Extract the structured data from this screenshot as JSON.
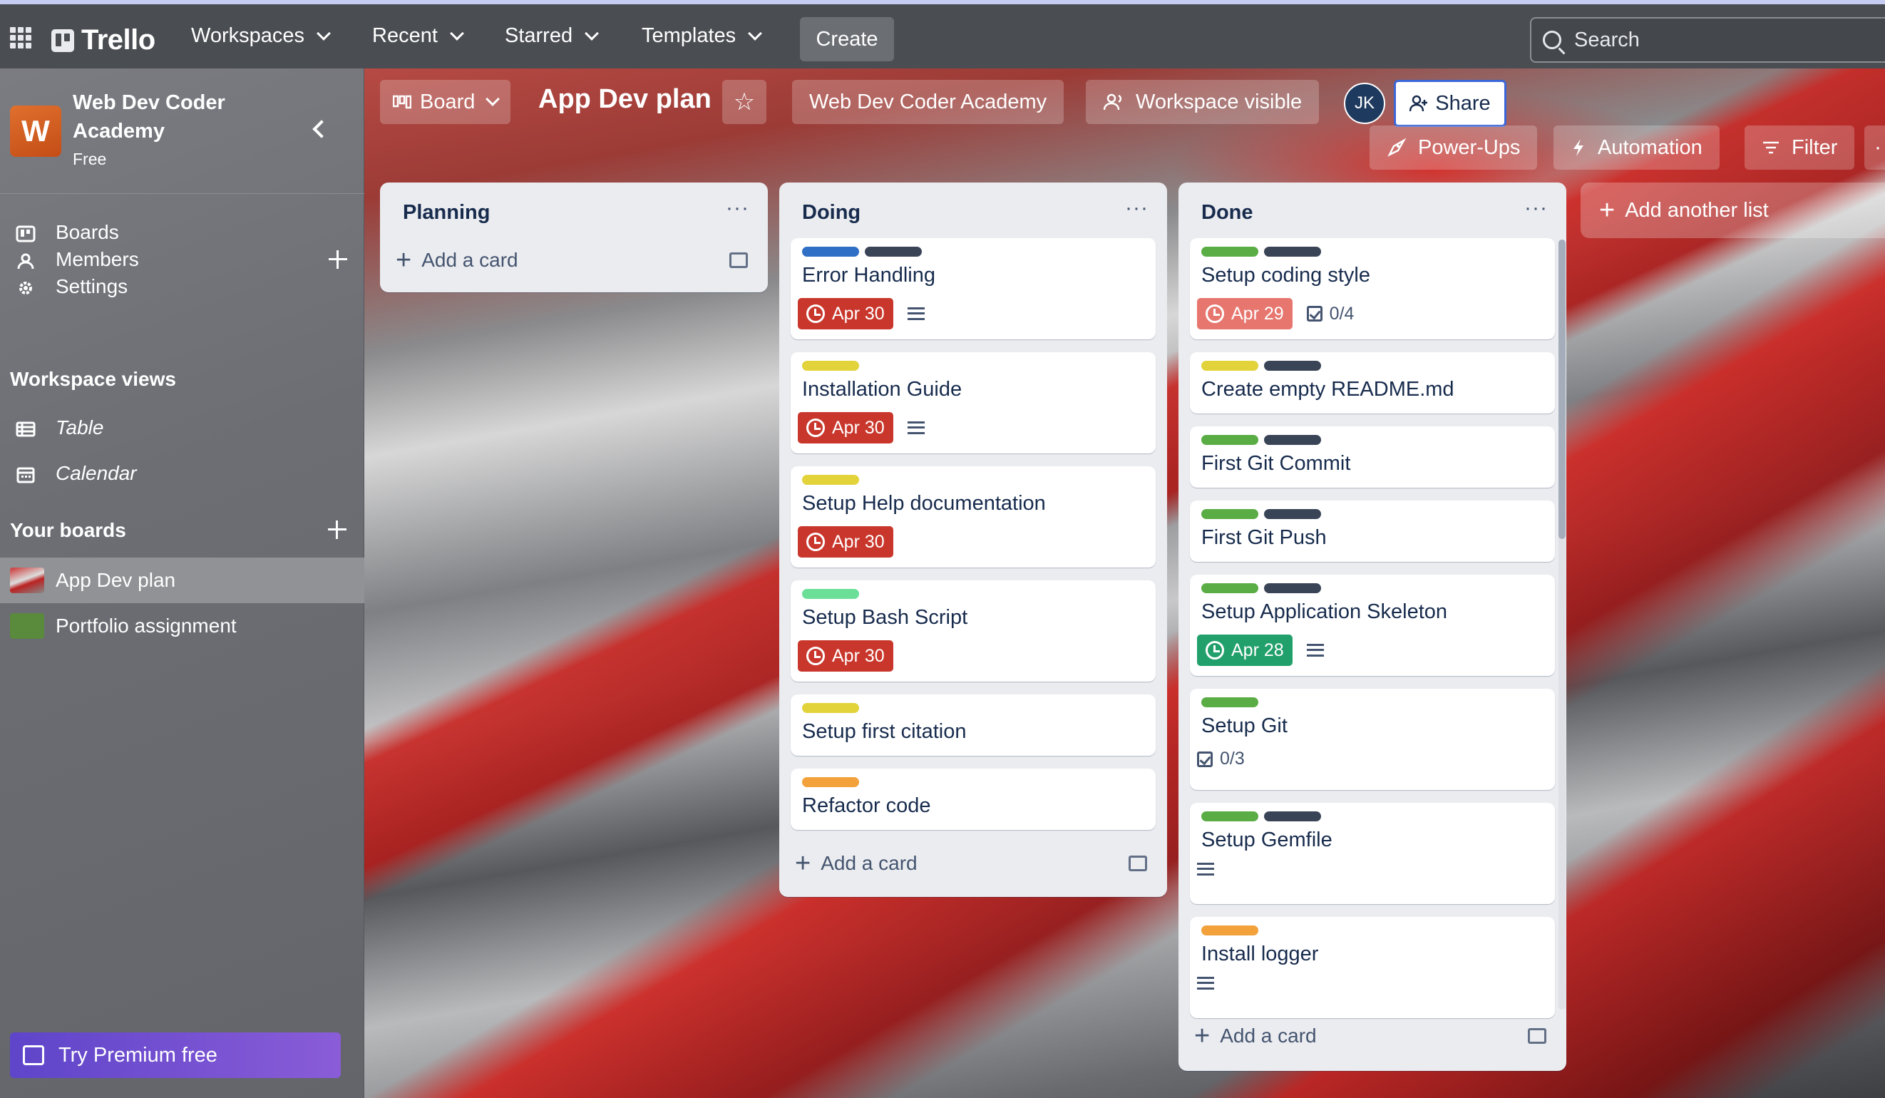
{
  "topbar": {
    "logo": "Trello",
    "nav": [
      "Workspaces",
      "Recent",
      "Starred",
      "Templates"
    ],
    "create": "Create",
    "search_placeholder": "Search"
  },
  "sidebar": {
    "workspace_initial": "W",
    "workspace_name": "Web Dev Coder Academy",
    "plan": "Free",
    "items": [
      {
        "label": "Boards",
        "icon": "boards-icon"
      },
      {
        "label": "Members",
        "icon": "members-icon"
      },
      {
        "label": "Settings",
        "icon": "settings-icon"
      }
    ],
    "views_heading": "Workspace views",
    "views": [
      {
        "label": "Table",
        "icon": "table-icon"
      },
      {
        "label": "Calendar",
        "icon": "calendar-icon"
      }
    ],
    "boards_heading": "Your boards",
    "boards": [
      {
        "label": "App Dev plan",
        "active": true
      },
      {
        "label": "Portfolio assignment",
        "active": false
      }
    ],
    "premium": "Try Premium free"
  },
  "board": {
    "view": "Board",
    "title": "App Dev plan",
    "workspace": "Web Dev Coder Academy",
    "visibility": "Workspace visible",
    "member_initials": "JK",
    "share": "Share",
    "power_ups": "Power-Ups",
    "automation": "Automation",
    "filter": "Filter",
    "add_list": "Add another list"
  },
  "lists": [
    {
      "title": "Planning",
      "menu": "···",
      "add_card": "Add a card",
      "cards": []
    },
    {
      "title": "Doing",
      "menu": "···",
      "add_card": "Add a card",
      "cards": [
        {
          "title": "Error Handling",
          "labels": [
            "#2f6fc5",
            "#3a4457"
          ],
          "due": "Apr 30",
          "due_color": "#c9372c",
          "desc": true
        },
        {
          "title": "Installation Guide",
          "labels": [
            "#e2d33b"
          ],
          "due": "Apr 30",
          "due_color": "#c9372c",
          "desc": true
        },
        {
          "title": "Setup Help documentation",
          "labels": [
            "#e2d33b"
          ],
          "due": "Apr 30",
          "due_color": "#c9372c"
        },
        {
          "title": "Setup Bash Script",
          "labels": [
            "#6bde98"
          ],
          "due": "Apr 30",
          "due_color": "#c9372c"
        },
        {
          "title": "Setup first citation",
          "labels": [
            "#e2d33b"
          ]
        },
        {
          "title": "Refactor code",
          "labels": [
            "#f2a13b"
          ]
        }
      ]
    },
    {
      "title": "Done",
      "menu": "···",
      "add_card": "Add a card",
      "cards": [
        {
          "title": "Setup coding style",
          "labels": [
            "#5aac44",
            "#3a4457"
          ],
          "due": "Apr 29",
          "due_color": "#e6766e",
          "checklist": "0/4"
        },
        {
          "title": "Create empty README.md",
          "labels": [
            "#e2d33b",
            "#3a4457"
          ]
        },
        {
          "title": "First Git Commit",
          "labels": [
            "#5aac44",
            "#3a4457"
          ]
        },
        {
          "title": "First Git Push",
          "labels": [
            "#5aac44",
            "#3a4457"
          ]
        },
        {
          "title": "Setup Application Skeleton",
          "labels": [
            "#5aac44",
            "#3a4457"
          ],
          "due": "Apr 28",
          "due_color": "#22a06b",
          "desc": true
        },
        {
          "title": "Setup Git",
          "labels": [
            "#5aac44"
          ],
          "checklist": "0/3"
        },
        {
          "title": "Setup Gemfile",
          "labels": [
            "#5aac44",
            "#3a4457"
          ],
          "desc": true
        },
        {
          "title": "Install logger",
          "labels": [
            "#f2a13b"
          ],
          "desc": true
        }
      ]
    }
  ]
}
